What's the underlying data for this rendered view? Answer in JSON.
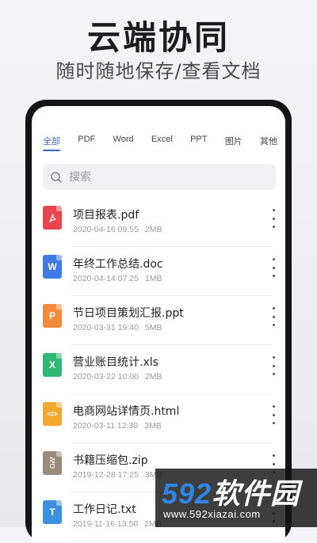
{
  "header": {
    "title": "云端协同",
    "subtitle": "随时随地保存/查看文档"
  },
  "tabs": [
    {
      "label": "全部",
      "active": true
    },
    {
      "label": "PDF"
    },
    {
      "label": "Word"
    },
    {
      "label": "Excel"
    },
    {
      "label": "PPT"
    },
    {
      "label": "图片"
    },
    {
      "label": "其他"
    }
  ],
  "search": {
    "placeholder": "搜索",
    "value": ""
  },
  "files": [
    {
      "name": "项目报表.pdf",
      "date": "2020-04-16 09:55",
      "size": "2MB",
      "icon": "pdf-icon",
      "color": "#e8464c"
    },
    {
      "name": "年终工作总结.doc",
      "date": "2020-04-14 07:25",
      "size": "1MB",
      "icon": "word-icon",
      "color": "#3f7ae6",
      "icon_text": "W"
    },
    {
      "name": "节日项目策划汇报.ppt",
      "date": "2020-03-31 19:40",
      "size": "5MB",
      "icon": "ppt-icon",
      "color": "#f18a3c",
      "icon_text": "P"
    },
    {
      "name": "营业账目统计.xls",
      "date": "2020-03-22 10:00",
      "size": "2MB",
      "icon": "excel-icon",
      "color": "#2fb874",
      "icon_text": "X"
    },
    {
      "name": "电商网站详情页.html",
      "date": "2020-03-11 12:30",
      "size": "3MB",
      "icon": "code-icon",
      "color": "#f4a72e",
      "icon_text": "</>"
    },
    {
      "name": "书籍压缩包.zip",
      "date": "2019-12-28 17:25",
      "size": "3MB",
      "icon": "zip-icon",
      "color": "#9a8a7b"
    },
    {
      "name": "工作日记.txt",
      "date": "2019-11-16 13:50",
      "size": "2MB",
      "icon": "txt-icon",
      "color": "#3d8fe0",
      "icon_text": "T"
    }
  ],
  "watermark": {
    "brand_number": "592",
    "brand_text": "软件园",
    "url": "www.592xiazai.com"
  }
}
